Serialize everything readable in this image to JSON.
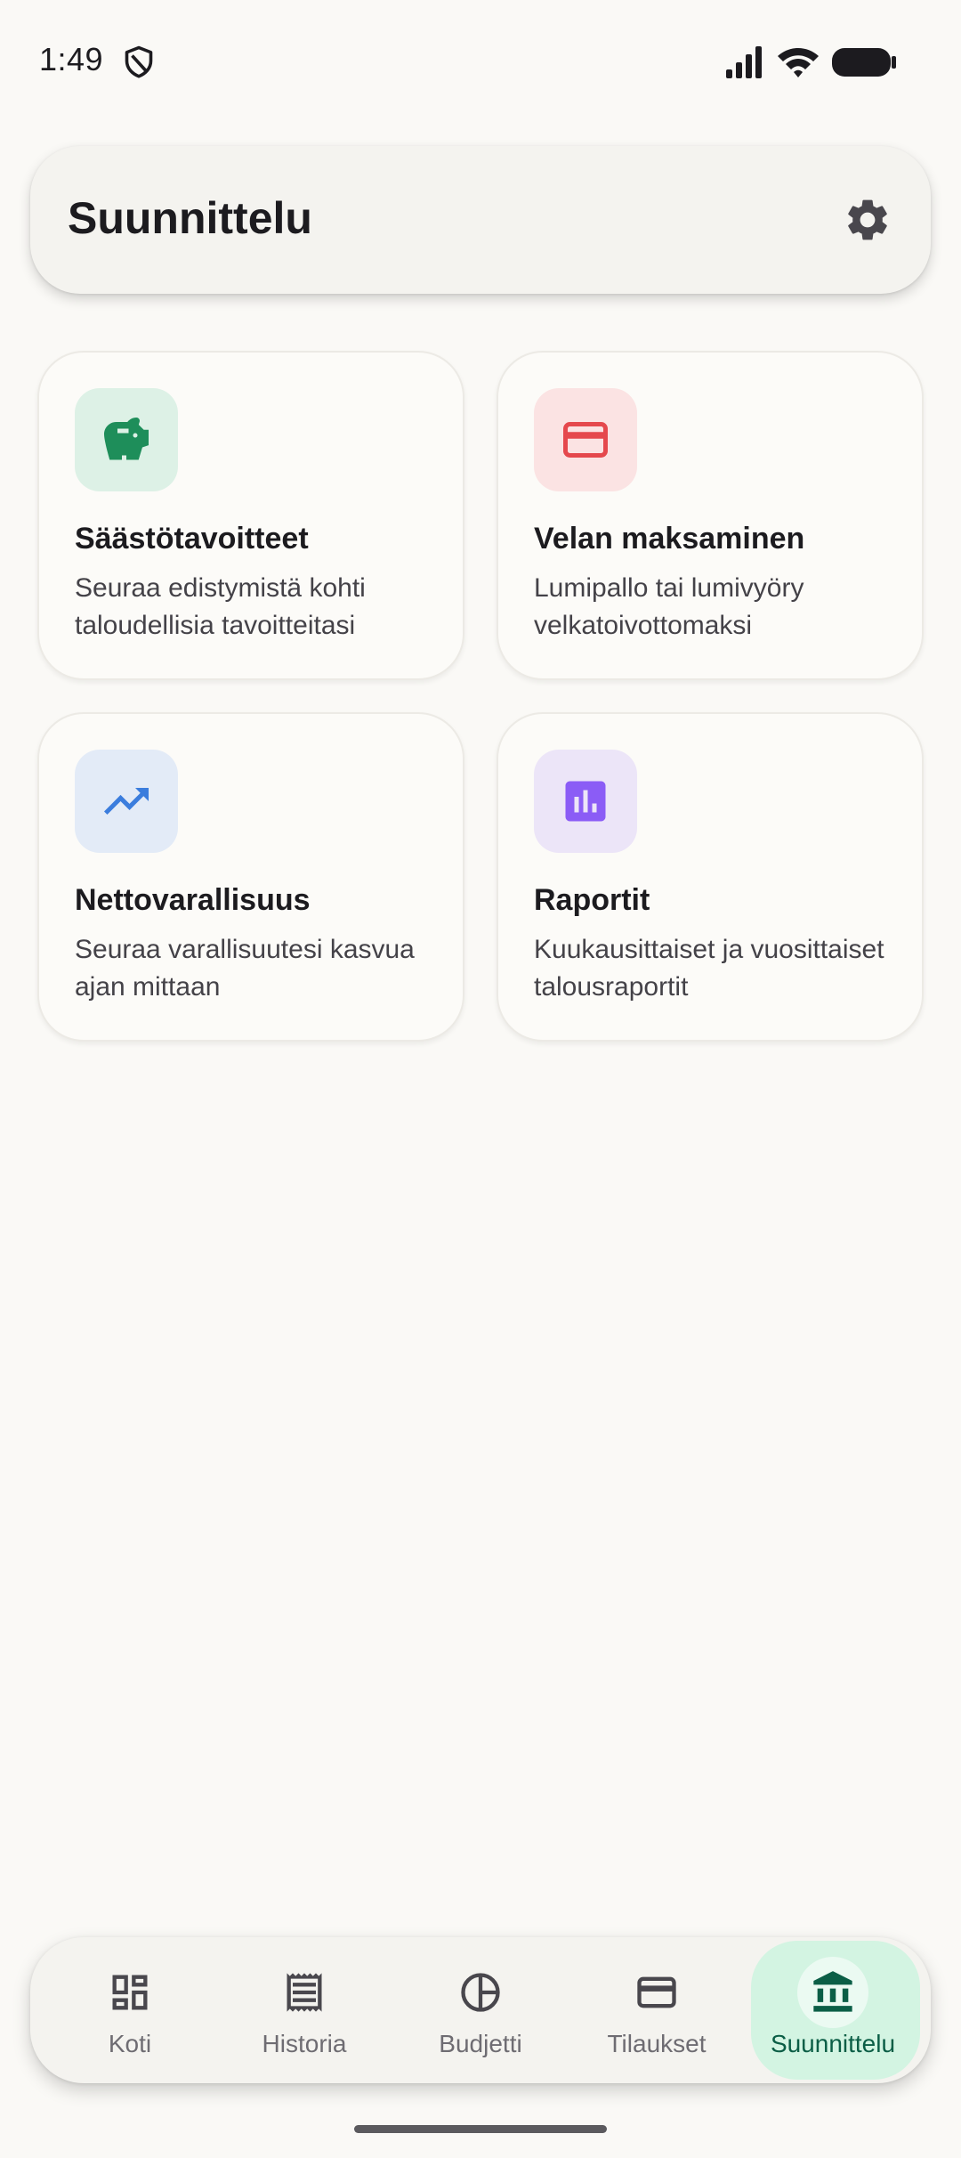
{
  "status_bar": {
    "time": "1:49"
  },
  "header": {
    "title": "Suunnittelu"
  },
  "cards": [
    {
      "title": "Säästötavoitteet",
      "description": "Seuraa edistymistä kohti taloudellisia tavoitteitasi",
      "icon": "piggy-bank-icon",
      "icon_color": "#1E8E5A",
      "icon_bg": "#DDF1E6"
    },
    {
      "title": "Velan maksaminen",
      "description": "Lumipallo tai lumivyöry velkatoivottomaksi",
      "icon": "credit-card-icon",
      "icon_color": "#E5484D",
      "icon_bg": "#FBE3E3"
    },
    {
      "title": "Nettovarallisuus",
      "description": "Seuraa varallisuutesi kasvua ajan mittaan",
      "icon": "trending-up-icon",
      "icon_color": "#3B7DDD",
      "icon_bg": "#E3EBF7"
    },
    {
      "title": "Raportit",
      "description": "Kuukausittaiset ja vuosittaiset talousraportit",
      "icon": "bar-chart-icon",
      "icon_color": "#8B5CF6",
      "icon_bg": "#ECE5F8"
    }
  ],
  "bottom_nav": {
    "items": [
      {
        "label": "Koti",
        "icon": "dashboard-icon"
      },
      {
        "label": "Historia",
        "icon": "receipt-icon"
      },
      {
        "label": "Budjetti",
        "icon": "pie-chart-icon"
      },
      {
        "label": "Tilaukset",
        "icon": "credit-card-icon"
      },
      {
        "label": "Suunnittelu",
        "icon": "bank-icon",
        "active": true
      }
    ],
    "active_color": "#0B5E46",
    "active_bg": "#D3F4E2"
  }
}
